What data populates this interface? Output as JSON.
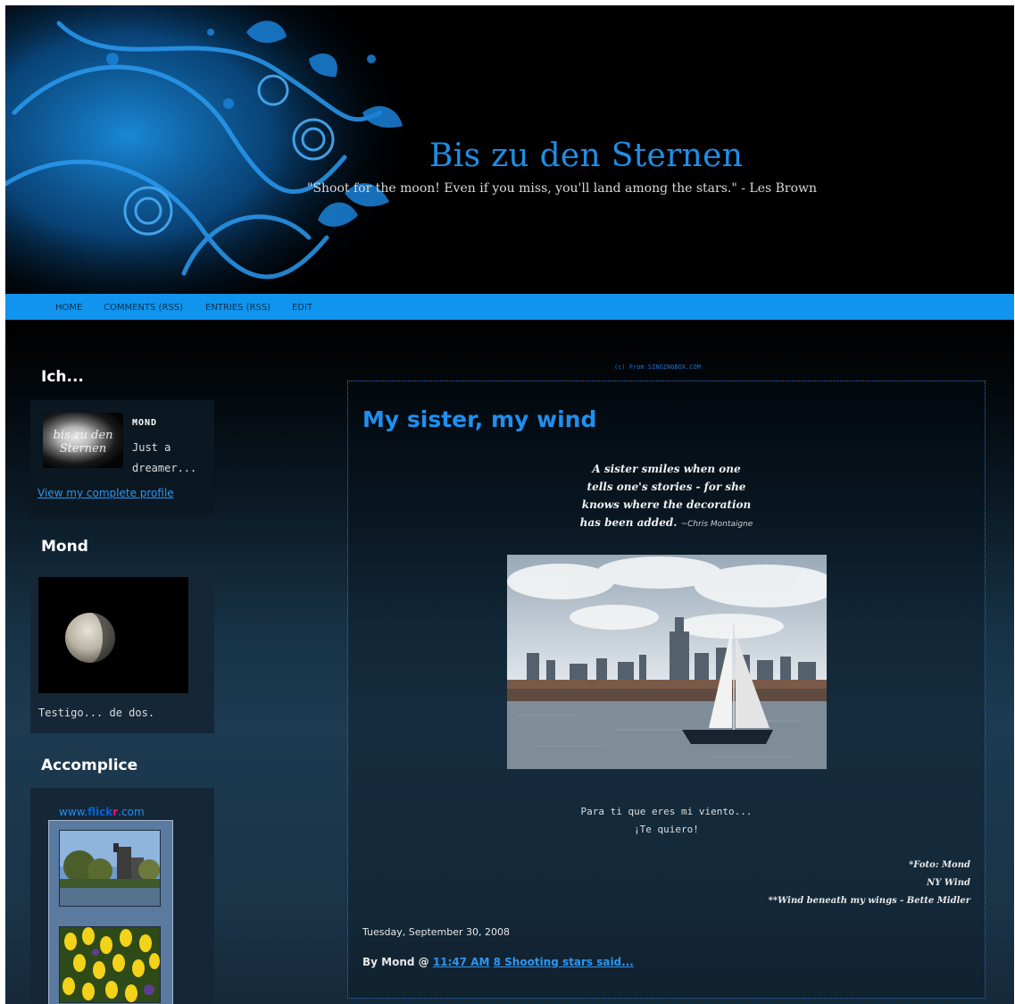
{
  "header": {
    "title": "Bis zu den Sternen",
    "description": "\"Shoot for the moon! Even if you miss, you'll land among the stars.\" - Les Brown"
  },
  "nav": {
    "items": [
      "HOME",
      "COMMENTS (RSS)",
      "ENTRIES (RSS)",
      "EDIT"
    ]
  },
  "sidebar": {
    "profile": {
      "title": "Ich...",
      "image_text": "bis zu den Sternen",
      "name": "MOND",
      "about": "Just a dreamer...",
      "link": "View my complete profile"
    },
    "moon": {
      "title": "Mond",
      "caption": "Testigo... de dos."
    },
    "accomplice": {
      "title": "Accomplice",
      "flickr_prefix": "www.",
      "flickr_brand_1": "flick",
      "flickr_brand_2": "r",
      "flickr_suffix": ".com"
    }
  },
  "credit": "(c) From SINGINGBOX.COM",
  "post": {
    "title": "My sister, my wind",
    "quote_lines": [
      "A sister smiles when one",
      "tells one's stories - for she",
      "knows where the decoration",
      "has been added."
    ],
    "quote_author": "~Chris Montaigne",
    "message_lines": [
      "Para ti que eres mi viento...",
      "¡Te quiero!"
    ],
    "notes": [
      "*Foto: Mond",
      "NY Wind",
      "**Wind beneath my wings - Bette Midler"
    ],
    "date": "Tuesday, September 30, 2008",
    "footer_prefix": "By Mond @ ",
    "time_link": "11:47 AM",
    "comments_link": "8 Shooting stars said..."
  },
  "colors": {
    "accent": "#1f8ff0",
    "navbar": "#1194ee",
    "page_background": "#000000"
  }
}
